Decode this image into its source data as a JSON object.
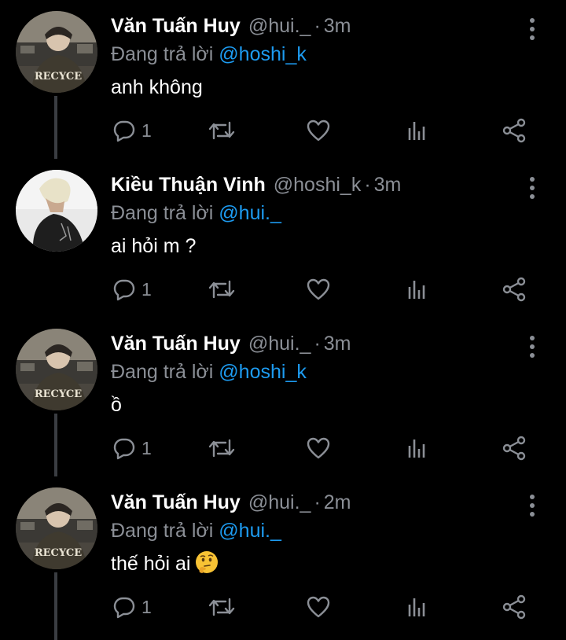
{
  "reply_prefix": "Đang trả lời",
  "colors": {
    "background": "#000000",
    "secondary_text": "#8b8f96",
    "link": "#1d9bf0",
    "thread_line": "#3a3d42"
  },
  "tweets": [
    {
      "name": "Văn Tuấn Huy",
      "handle": "@hui._",
      "dot": "·",
      "time": "3m",
      "reply_to": "@hoshi_k",
      "text": "anh không",
      "emoji": "",
      "reply_count": "1",
      "avatar_icon": "avatar-photo",
      "hoodie_text": "RECYCE"
    },
    {
      "name": "Kiều Thuận Vinh",
      "handle": "@hoshi_k",
      "dot": "·",
      "time": "3m",
      "reply_to": "@hui._",
      "text": "ai hỏi m ?",
      "emoji": "",
      "reply_count": "1",
      "avatar_icon": "avatar-photo"
    },
    {
      "name": "Văn Tuấn Huy",
      "handle": "@hui._",
      "dot": "·",
      "time": "3m",
      "reply_to": "@hoshi_k",
      "text": "ồ",
      "emoji": "",
      "reply_count": "1",
      "avatar_icon": "avatar-photo",
      "hoodie_text": "RECYCE"
    },
    {
      "name": "Văn Tuấn Huy",
      "handle": "@hui._",
      "dot": "·",
      "time": "2m",
      "reply_to": "@hui._",
      "text": "thế hỏi ai",
      "emoji": "thinking-face",
      "reply_count": "1",
      "avatar_icon": "avatar-photo",
      "hoodie_text": "RECYCE"
    }
  ]
}
